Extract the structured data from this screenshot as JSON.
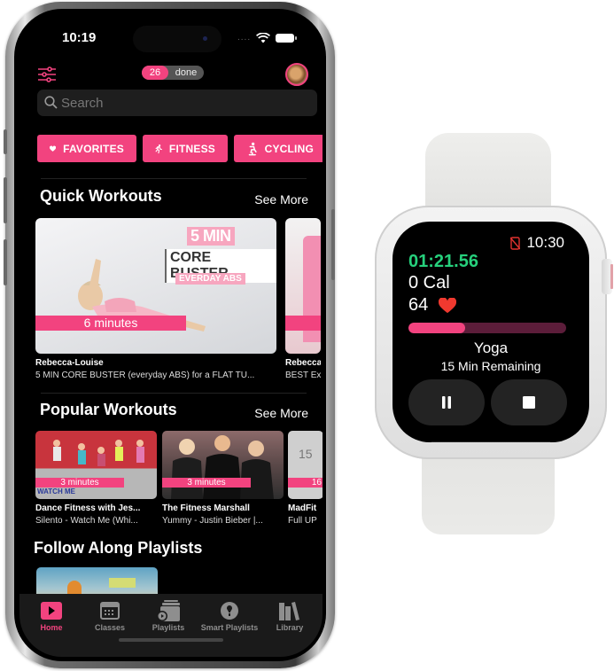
{
  "phone": {
    "status_bar": {
      "time": "10:19",
      "signal": "....",
      "wifi_icon": "wifi-icon",
      "battery_icon": "battery-icon"
    },
    "header": {
      "filter_icon": "sliders-icon",
      "done_count": "26",
      "done_label": "done",
      "avatar_icon": "dog-avatar"
    },
    "search": {
      "placeholder": "Search",
      "value": ""
    },
    "categories": [
      {
        "label": "FAVORITES",
        "icon": "heart-icon"
      },
      {
        "label": "FITNESS",
        "icon": "runner-icon"
      },
      {
        "label": "CYCLING",
        "icon": "cyclist-icon"
      }
    ],
    "quick_workouts": {
      "title": "Quick Workouts",
      "see_more": "See More",
      "items": [
        {
          "thumb_text": [
            "5 MIN",
            "CORE BUSTER",
            "EVERDAY ABS"
          ],
          "duration": "6 minutes",
          "author": "Rebecca-Louise",
          "subtitle": "5 MIN CORE BUSTER (everyday ABS) for a FLAT TU..."
        },
        {
          "duration": "",
          "author": "Rebecca-Louise",
          "subtitle": "BEST Ex"
        }
      ]
    },
    "popular_workouts": {
      "title": "Popular Workouts",
      "see_more": "See More",
      "items": [
        {
          "duration": "3 minutes",
          "thumb_text": "WATCH ME",
          "author": "Dance Fitness with Jes...",
          "subtitle": "Silento - Watch Me (Whi..."
        },
        {
          "duration": "3 minutes",
          "author": "The Fitness Marshall",
          "subtitle": "Yummy - Justin Bieber |..."
        },
        {
          "duration": "16",
          "thumb_text": "15",
          "author": "MadFit",
          "subtitle": "Full UP"
        }
      ]
    },
    "follow_along": {
      "title": "Follow Along Playlists"
    },
    "tabbar": {
      "active": "Home",
      "items": [
        {
          "label": "Home",
          "icon": "play-square-icon"
        },
        {
          "label": "Classes",
          "icon": "calendar-icon"
        },
        {
          "label": "Playlists",
          "icon": "playlist-stack-icon"
        },
        {
          "label": "Smart Playlists",
          "icon": "lightbulb-icon"
        },
        {
          "label": "Library",
          "icon": "books-icon"
        }
      ]
    }
  },
  "watch": {
    "time": "10:30",
    "no_phone_icon": "phone-disconnected-icon",
    "elapsed": "01:21.56",
    "calories": "0 Cal",
    "heart_rate": "64",
    "progress_fraction": 0.36,
    "activity": "Yoga",
    "remaining": "15 Min Remaining",
    "controls": [
      {
        "label": "pause",
        "icon": "pause-icon"
      },
      {
        "label": "stop",
        "icon": "stop-icon"
      }
    ]
  },
  "colors": {
    "accent_pink": "#f2437f",
    "timer_green": "#26d07c",
    "progress_track": "#5c1d3a",
    "heart_red": "#f0392f"
  }
}
